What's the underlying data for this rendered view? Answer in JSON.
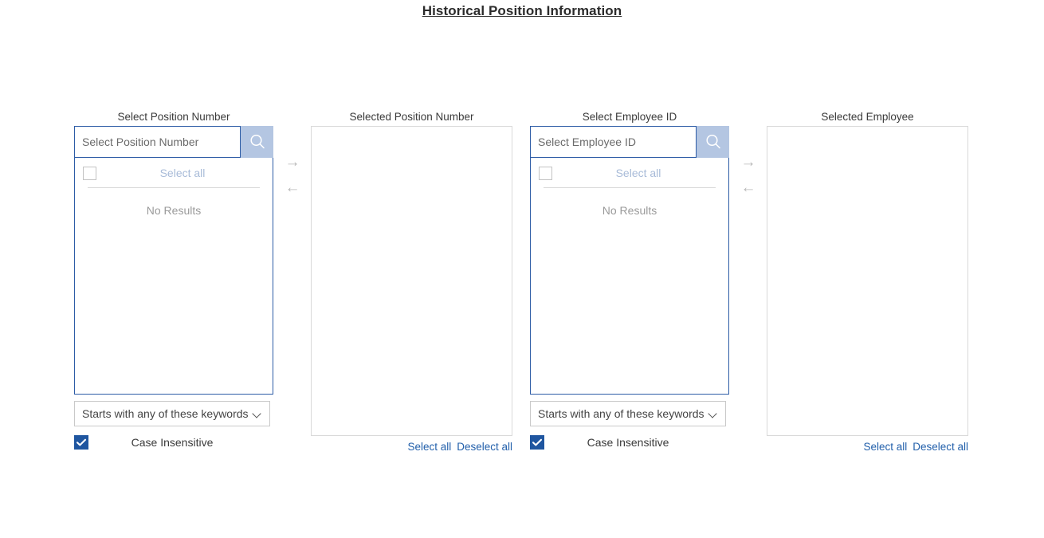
{
  "page": {
    "title": "Historical Position Information"
  },
  "icons": {
    "search": "search-icon",
    "chevron_down": "chevron-down-icon",
    "checkmark": "check-icon",
    "arrow_right": "→",
    "arrow_left": "←"
  },
  "colors": {
    "accent_blue": "#2d5ca6",
    "checkbox_checked": "#1f56a0",
    "search_button_bg": "#b4c6e2",
    "link_blue": "#2360ab",
    "disabled_text": "#a8bbd8",
    "muted_text": "#9a9a9a",
    "panel_border_gray": "#d9d9d9"
  },
  "panels": {
    "position": {
      "label": "Select Position Number",
      "search_placeholder": "Select Position Number",
      "search_value": "",
      "select_all_label": "Select all",
      "no_results_label": "No Results",
      "keyword_option": "Starts with any of these keywords",
      "case_insensitive_label": "Case Insensitive",
      "case_insensitive_checked": true,
      "select_all_checked": false
    },
    "selected_position": {
      "label": "Selected Position Number",
      "items": [],
      "select_all_link": "Select all",
      "deselect_all_link": "Deselect all"
    },
    "employee": {
      "label": "Select Employee ID",
      "search_placeholder": "Select Employee ID",
      "search_value": "",
      "select_all_label": "Select all",
      "no_results_label": "No Results",
      "keyword_option": "Starts with any of these keywords",
      "case_insensitive_label": "Case Insensitive",
      "case_insensitive_checked": true,
      "select_all_checked": false
    },
    "selected_employee": {
      "label": "Selected Employee",
      "items": [],
      "select_all_link": "Select all",
      "deselect_all_link": "Deselect all"
    }
  },
  "transfer": {
    "move_right_label": "→",
    "move_left_label": "←"
  }
}
